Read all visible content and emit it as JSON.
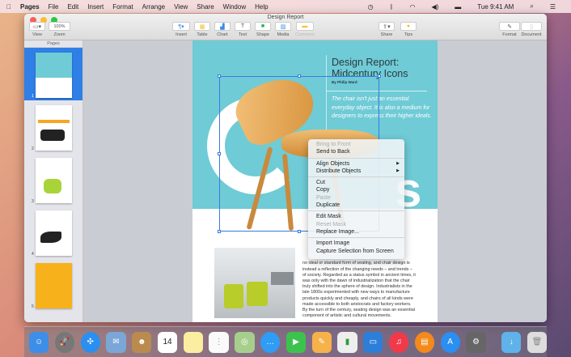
{
  "menubar": {
    "apple": "",
    "app": "Pages",
    "items": [
      "File",
      "Edit",
      "Insert",
      "Format",
      "Arrange",
      "View",
      "Share",
      "Window",
      "Help"
    ],
    "clock": "Tue 9:41 AM"
  },
  "window": {
    "title": "Design Report"
  },
  "toolbar": {
    "view": "View",
    "zoom_value": "100%",
    "zoom": "Zoom",
    "insert": "Insert",
    "table": "Table",
    "chart": "Chart",
    "text": "Text",
    "shape": "Shape",
    "media": "Media",
    "comment": "Comment",
    "share": "Share",
    "tips": "Tips",
    "format": "Format",
    "document": "Document"
  },
  "sidebar": {
    "header": "Pages",
    "pages": [
      "1",
      "2",
      "3",
      "4",
      "5"
    ],
    "selected": "1"
  },
  "document": {
    "title_line1": "Design Report:",
    "title_line2": "Midcentury Icons",
    "byline": "By Philip Ward",
    "quote": "The chair isn't just an essential everyday object. It is also a medium for designers to express their higher ideals.",
    "big_letters": "s",
    "body": [
      "no ideal or standard form of seating, and chair design is",
      "instead a reflection of the changing needs – and trends –",
      "of society. Regarded as a status symbol in ancient times, it",
      "was only with the dawn of industrialization that the chair",
      "truly shifted into the sphere of design. Industrialists in the",
      "late 1800s experimented with new ways to manufacture",
      "products quickly and cheaply, and chairs of all kinds were",
      "made accessible to both aristocrats and factory workers.",
      "By the turn of the century, seating design was an essential",
      "component of artistic and cultural movements."
    ]
  },
  "context_menu": {
    "bring_to_front": "Bring to Front",
    "send_to_back": "Send to Back",
    "align": "Align Objects",
    "distribute": "Distribute Objects",
    "cut": "Cut",
    "copy": "Copy",
    "paste": "Paste",
    "duplicate": "Duplicate",
    "edit_mask": "Edit Mask",
    "reset_mask": "Reset Mask",
    "replace_image": "Replace Image...",
    "import_image": "Import Image",
    "capture": "Capture Selection from Screen"
  },
  "dock": {
    "calendar_day": "14"
  },
  "colors": {
    "accent": "#2f7fe6",
    "teal": "#6fcbd6"
  }
}
